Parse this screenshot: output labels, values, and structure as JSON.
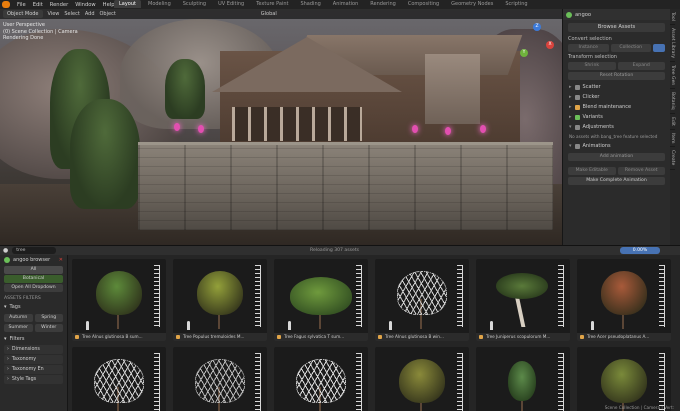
{
  "topbar": {
    "menus": [
      "File",
      "Edit",
      "Render",
      "Window",
      "Help"
    ],
    "workspaces": [
      "Layout",
      "Modeling",
      "Sculpting",
      "UV Editing",
      "Texture Paint",
      "Shading",
      "Animation",
      "Rendering",
      "Compositing",
      "Geometry Nodes",
      "Scripting"
    ],
    "active_workspace": "Layout"
  },
  "viewport": {
    "mode": "Object Mode",
    "menus": [
      "View",
      "Select",
      "Add",
      "Object"
    ],
    "transform": "Global",
    "info": [
      "User Perspective",
      "(0) Scene Collection | Camera",
      "Rendering Done"
    ],
    "gizmo": {
      "x": "X",
      "y": "Y",
      "z": "Z"
    }
  },
  "npanel": {
    "header": "angoo",
    "title": "Browse Assets",
    "convert_label": "Convert selection",
    "convert_buttons": [
      "Instance",
      "Collection"
    ],
    "transform_label": "Transform selection",
    "transform_buttons": [
      "Shrink",
      "Expand"
    ],
    "reset_label": "Reset Rotation",
    "sections": [
      {
        "label": "Scatter",
        "color": ""
      },
      {
        "label": "Clicker",
        "color": ""
      },
      {
        "label": "Blend maintenance",
        "color": "#e0a448"
      },
      {
        "label": "Variants",
        "color": "#6bbf59"
      },
      {
        "label": "Adjustments",
        "color": ""
      }
    ],
    "note": "No assets with bang_tree feature selected",
    "animations_label": "Animations",
    "add_animation": "Add animation",
    "bottom_buttons": [
      "Make Editable",
      "Remove Asset"
    ],
    "bottom_wide": "Make Complete Animation",
    "tabs": [
      "Tool",
      "Asset Library",
      "Tree Gen",
      "Botaniq",
      "Edit",
      "Item",
      "Create"
    ]
  },
  "browser": {
    "search_value": "tree",
    "title": "Reloading 307 assets",
    "zoom": "0.00%",
    "sidebar": {
      "header": "angoo browser",
      "all_label": "All",
      "all_sub": "Botanical",
      "open_label": "Open All Dropdown",
      "filters_head": "ASSETS FILTERS",
      "tags_label": "Tags",
      "tags": [
        "Autumn",
        "Spring",
        "Summer",
        "Winter"
      ],
      "filters_label": "Filters",
      "filter_items": [
        "Dimensions",
        "Taxonomy",
        "Taxonomy En",
        "Style Tags"
      ]
    },
    "status": "Scene Collection | Camera | Vert:"
  },
  "assets": [
    {
      "name": "Tree Alnus glutinosa B sum...",
      "crown": "#5d8a3a",
      "shape": "full"
    },
    {
      "name": "Tree Populus tremuloides M...",
      "crown": "#93a03a",
      "shape": "full"
    },
    {
      "name": "Tree Fagus sylvatica T sum...",
      "crown": "#6f9a3d",
      "shape": "wide"
    },
    {
      "name": "Tree Alnus glutinosa B win...",
      "crown": "#cfcfcf",
      "shape": "bare"
    },
    {
      "name": "Tree Juniperus scopulorum M...",
      "crown": "#5a7a3a",
      "shape": "bonsai"
    },
    {
      "name": "Tree Acer pseudoplatanus A...",
      "crown": "#a85a3a",
      "shape": "full"
    },
    {
      "name": "",
      "crown": "#d0d0d0",
      "shape": "bare"
    },
    {
      "name": "",
      "crown": "#b8b8b8",
      "shape": "bare"
    },
    {
      "name": "",
      "crown": "#d8d8d8",
      "shape": "bare"
    },
    {
      "name": "",
      "crown": "#8a8a3a",
      "shape": "full"
    },
    {
      "name": "",
      "crown": "#5c8a4a",
      "shape": "thin"
    },
    {
      "name": "",
      "crown": "#7a8a3a",
      "shape": "full"
    }
  ]
}
